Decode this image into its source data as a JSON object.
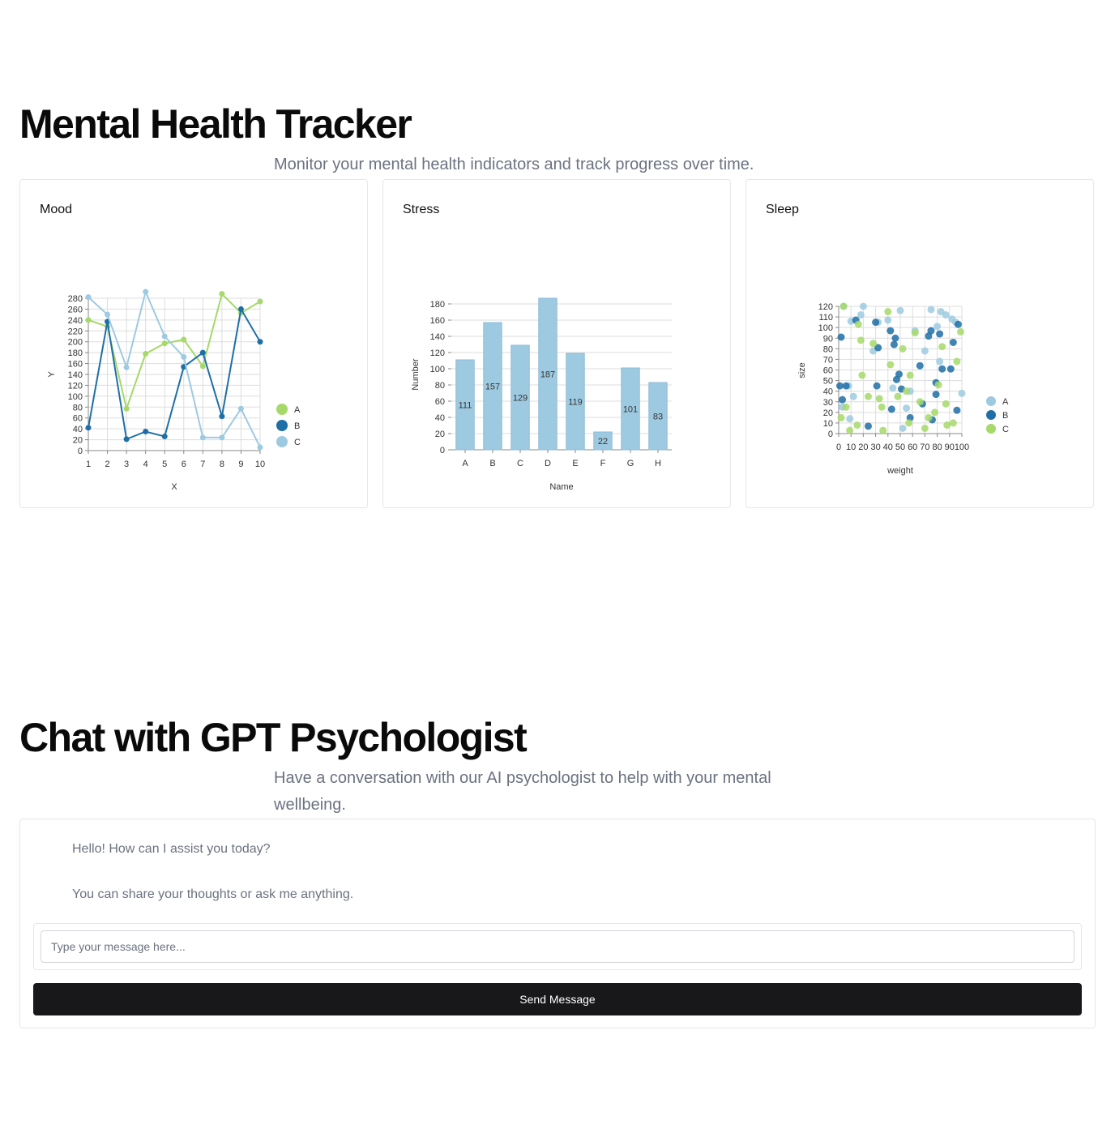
{
  "tracker": {
    "title": "Mental Health Tracker",
    "subtitle": "Monitor your mental health indicators and track progress over time."
  },
  "cards": {
    "mood": {
      "title": "Mood"
    },
    "stress": {
      "title": "Stress"
    },
    "sleep": {
      "title": "Sleep"
    }
  },
  "colors": {
    "series_a": "#a6d96a",
    "series_b": "#1f6fa6",
    "series_c": "#9ecae1",
    "bar": "#9ecae1",
    "button_bg": "#18181b"
  },
  "chart_data": [
    {
      "type": "line",
      "xlabel": "X",
      "ylabel": "Y",
      "x": [
        1,
        2,
        3,
        4,
        5,
        6,
        7,
        8,
        9,
        10
      ],
      "xticks": [
        "1",
        "2",
        "3",
        "4",
        "5",
        "6",
        "7",
        "8",
        "9",
        "10"
      ],
      "ylim": [
        0,
        280
      ],
      "yticks": [
        "0",
        "20",
        "40",
        "60",
        "80",
        "100",
        "120",
        "140",
        "160",
        "180",
        "200",
        "220",
        "240",
        "260",
        "280"
      ],
      "grid": true,
      "legend": "right",
      "series": [
        {
          "name": "A",
          "values": [
            240,
            228,
            77,
            178,
            197,
            204,
            155,
            288,
            253,
            274
          ]
        },
        {
          "name": "B",
          "values": [
            42,
            237,
            21,
            35,
            26,
            154,
            180,
            63,
            260,
            200
          ]
        },
        {
          "name": "C",
          "values": [
            282,
            250,
            153,
            292,
            210,
            172,
            24,
            24,
            77,
            6
          ]
        }
      ]
    },
    {
      "type": "bar",
      "xlabel": "Name",
      "ylabel": "Number",
      "categories": [
        "A",
        "B",
        "C",
        "D",
        "E",
        "F",
        "G",
        "H"
      ],
      "values": [
        111,
        157,
        129,
        187,
        119,
        22,
        101,
        83
      ],
      "ylim": [
        0,
        180
      ],
      "yticks": [
        "0",
        "20",
        "40",
        "60",
        "80",
        "100",
        "120",
        "140",
        "160",
        "180"
      ],
      "grid": true
    },
    {
      "type": "scatter",
      "xlabel": "weight",
      "ylabel": "size",
      "xlim": [
        0,
        100
      ],
      "ylim": [
        0,
        120
      ],
      "xticks": [
        "0",
        "10",
        "20",
        "30",
        "40",
        "50",
        "60",
        "70",
        "80",
        "90",
        "100"
      ],
      "yticks": [
        "0",
        "10",
        "20",
        "30",
        "40",
        "50",
        "60",
        "70",
        "80",
        "90",
        "100",
        "110",
        "120"
      ],
      "grid": true,
      "legend": "right",
      "series": [
        {
          "name": "A",
          "points": [
            [
              4,
              120
            ],
            [
              10,
              106
            ],
            [
              18,
              112
            ],
            [
              20,
              120
            ],
            [
              28,
              78
            ],
            [
              32,
              105
            ],
            [
              40,
              107
            ],
            [
              44,
              43
            ],
            [
              50,
              116
            ],
            [
              52,
              5
            ],
            [
              55,
              24
            ],
            [
              58,
              40
            ],
            [
              62,
              97
            ],
            [
              70,
              78
            ],
            [
              75,
              117
            ],
            [
              80,
              101
            ],
            [
              82,
              68
            ],
            [
              83,
              115
            ],
            [
              87,
              112
            ],
            [
              92,
              108
            ],
            [
              95,
              105
            ],
            [
              100,
              38
            ],
            [
              3,
              25
            ],
            [
              8,
              45
            ],
            [
              12,
              35
            ],
            [
              9,
              14
            ]
          ]
        },
        {
          "name": "B",
          "points": [
            [
              2,
              91
            ],
            [
              3,
              32
            ],
            [
              6,
              45
            ],
            [
              14,
              107
            ],
            [
              24,
              7
            ],
            [
              30,
              105
            ],
            [
              32,
              81
            ],
            [
              31,
              45
            ],
            [
              42,
              97
            ],
            [
              43,
              23
            ],
            [
              45,
              84
            ],
            [
              46,
              90
            ],
            [
              47,
              51
            ],
            [
              49,
              56
            ],
            [
              51,
              42
            ],
            [
              58,
              15
            ],
            [
              66,
              64
            ],
            [
              68,
              28
            ],
            [
              73,
              92
            ],
            [
              75,
              97
            ],
            [
              76,
              13
            ],
            [
              79,
              37
            ],
            [
              79,
              48
            ],
            [
              82,
              94
            ],
            [
              84,
              61
            ],
            [
              91,
              61
            ],
            [
              93,
              86
            ],
            [
              97,
              103
            ],
            [
              96,
              22
            ],
            [
              1,
              45
            ]
          ]
        },
        {
          "name": "C",
          "points": [
            [
              4,
              120
            ],
            [
              9,
              3
            ],
            [
              15,
              8
            ],
            [
              16,
              103
            ],
            [
              18,
              88
            ],
            [
              19,
              55
            ],
            [
              24,
              35
            ],
            [
              28,
              85
            ],
            [
              33,
              33
            ],
            [
              35,
              25
            ],
            [
              36,
              3
            ],
            [
              40,
              115
            ],
            [
              42,
              65
            ],
            [
              48,
              35
            ],
            [
              52,
              80
            ],
            [
              55,
              40
            ],
            [
              57,
              10
            ],
            [
              58,
              55
            ],
            [
              62,
              95
            ],
            [
              66,
              30
            ],
            [
              70,
              5
            ],
            [
              73,
              15
            ],
            [
              78,
              20
            ],
            [
              81,
              46
            ],
            [
              84,
              82
            ],
            [
              87,
              28
            ],
            [
              88,
              8
            ],
            [
              93,
              10
            ],
            [
              96,
              68
            ],
            [
              99,
              96
            ],
            [
              2,
              15
            ],
            [
              6,
              25
            ]
          ]
        }
      ]
    }
  ],
  "chat": {
    "title": "Chat with GPT Psychologist",
    "subtitle_line1": "Have a conversation with our AI psychologist to help with your mental",
    "subtitle_line2": "wellbeing.",
    "messages": [
      "Hello! How can I assist you today?",
      "You can share your thoughts or ask me anything."
    ],
    "input_placeholder": "Type your message here...",
    "send_label": "Send Message"
  }
}
